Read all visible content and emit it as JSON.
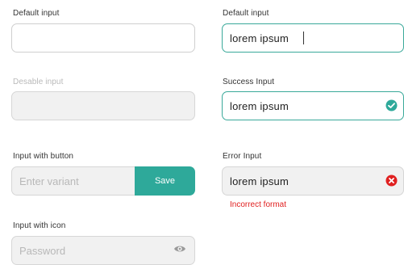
{
  "left": {
    "default": {
      "label": "Default input",
      "value": ""
    },
    "disabled": {
      "label": "Desable input",
      "value": ""
    },
    "with_button": {
      "label": "Input with button",
      "placeholder": "Enter variant",
      "button_label": "Save"
    },
    "with_icon": {
      "label": "Input with icon",
      "placeholder": "Password",
      "icon": "eye-icon"
    }
  },
  "right": {
    "default": {
      "label": "Default input",
      "value": "lorem ipsum"
    },
    "success": {
      "label": "Success Input",
      "value": "lorem ipsum",
      "icon": "check-circle-icon"
    },
    "error": {
      "label": "Error Input",
      "value": "lorem ipsum",
      "icon": "error-circle-icon",
      "message": "Incorrect format"
    }
  },
  "colors": {
    "accent": "#2ea99a",
    "error": "#e02020",
    "disabled_bg": "#f1f1f1"
  }
}
